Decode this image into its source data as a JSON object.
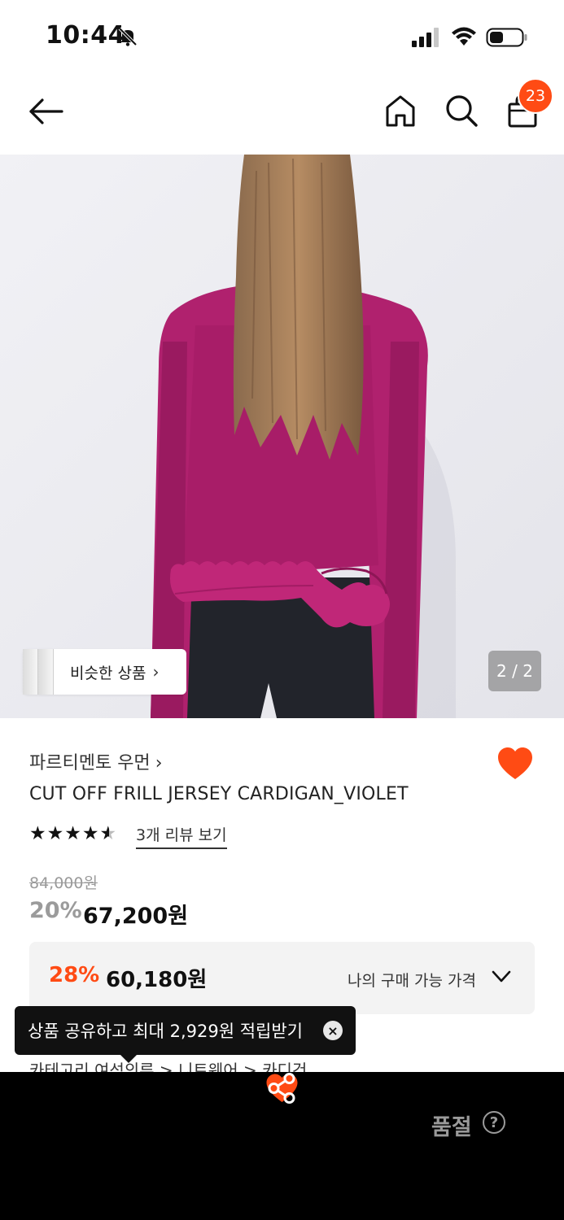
{
  "status_bar": {
    "time": "10:44"
  },
  "nav": {
    "cart_count": "23"
  },
  "gallery": {
    "similar_label": "비슷한 상품",
    "chevron": "›",
    "page_indicator": "2 / 2"
  },
  "product": {
    "brand": "파르티멘토 우먼",
    "brand_chevron": "›",
    "title": "CUT OFF FRILL JERSEY CARDIGAN_VIOLET",
    "rating": 4.5,
    "stars": [
      "★",
      "★",
      "★",
      "★",
      "★"
    ],
    "review_link": "3개 리뷰 보기",
    "original_price": "84,000원",
    "discount_rate": "20%",
    "sale_price": "67,200원"
  },
  "my_price": {
    "rate": "28%",
    "price": "60,180원",
    "label": "나의 구매 가능 가격"
  },
  "category_line": "카테고리        여성의류  >  니트웨어  >  카디건",
  "tooltip": {
    "text": "상품 공유하고 최대 2,929원 적립받기",
    "close": "×"
  },
  "bottom_bar": {
    "status": "품절",
    "help": "?"
  },
  "colors": {
    "accent": "#ff4b14",
    "bottom_bar": "#000000",
    "muted": "#9a9a9a"
  },
  "icons": [
    "bell-mute-icon",
    "signal-icon",
    "wifi-icon",
    "battery-icon",
    "back-arrow-icon",
    "home-icon",
    "search-icon",
    "shopping-bag-icon",
    "heart-icon",
    "share-icon",
    "chevron-down-icon",
    "close-icon",
    "help-icon"
  ]
}
